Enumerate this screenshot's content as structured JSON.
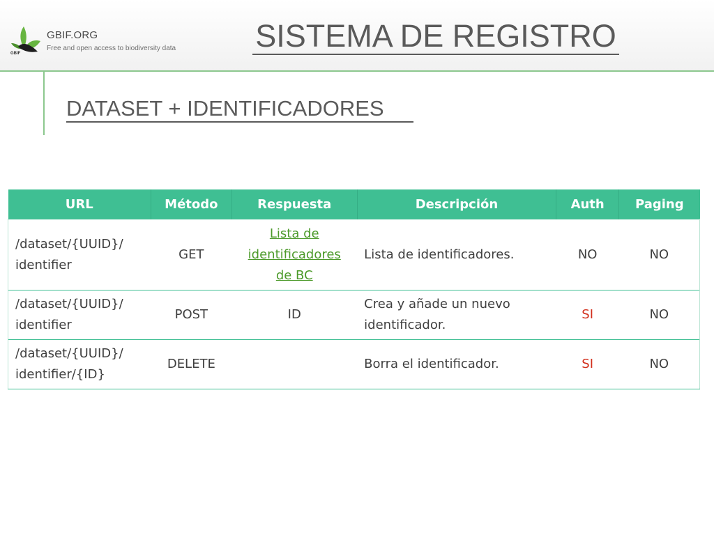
{
  "header": {
    "logo_name": "GBIF.ORG",
    "logo_small": "GBIF",
    "logo_tagline": "Free and open access to biodiversity data",
    "title": "SISTEMA DE REGISTRO"
  },
  "slide": {
    "subtitle": "DATASET + IDENTIFICADORES"
  },
  "table": {
    "headers": [
      "URL",
      "Método",
      "Respuesta",
      "Descripción",
      "Auth",
      "Paging"
    ],
    "rows": [
      {
        "url_line1": "/dataset/{UUID}/",
        "url_line2": "identifier",
        "method": "GET",
        "response_line1": "Lista de",
        "response_line2": "identificadores",
        "response_line3": "de BC",
        "description": "Lista de identificadores.",
        "auth": "NO",
        "paging": "NO"
      },
      {
        "url_line1": "/dataset/{UUID}/",
        "url_line2": "identifier",
        "method": "POST",
        "response": "ID",
        "description_line1": "Crea y añade un nuevo",
        "description_line2": "identificador.",
        "auth": "SI",
        "paging": "NO"
      },
      {
        "url_line1": "/dataset/{UUID}/",
        "url_line2": "identifier/{ID}",
        "method": "DELETE",
        "response": "",
        "description": "Borra el identificador.",
        "auth": "SI",
        "paging": "NO"
      }
    ]
  },
  "colors": {
    "table_header": "#3fbf93",
    "link": "#4c9a2a",
    "auth_required": "#d22f1c",
    "accent_line": "#8cc88e"
  }
}
